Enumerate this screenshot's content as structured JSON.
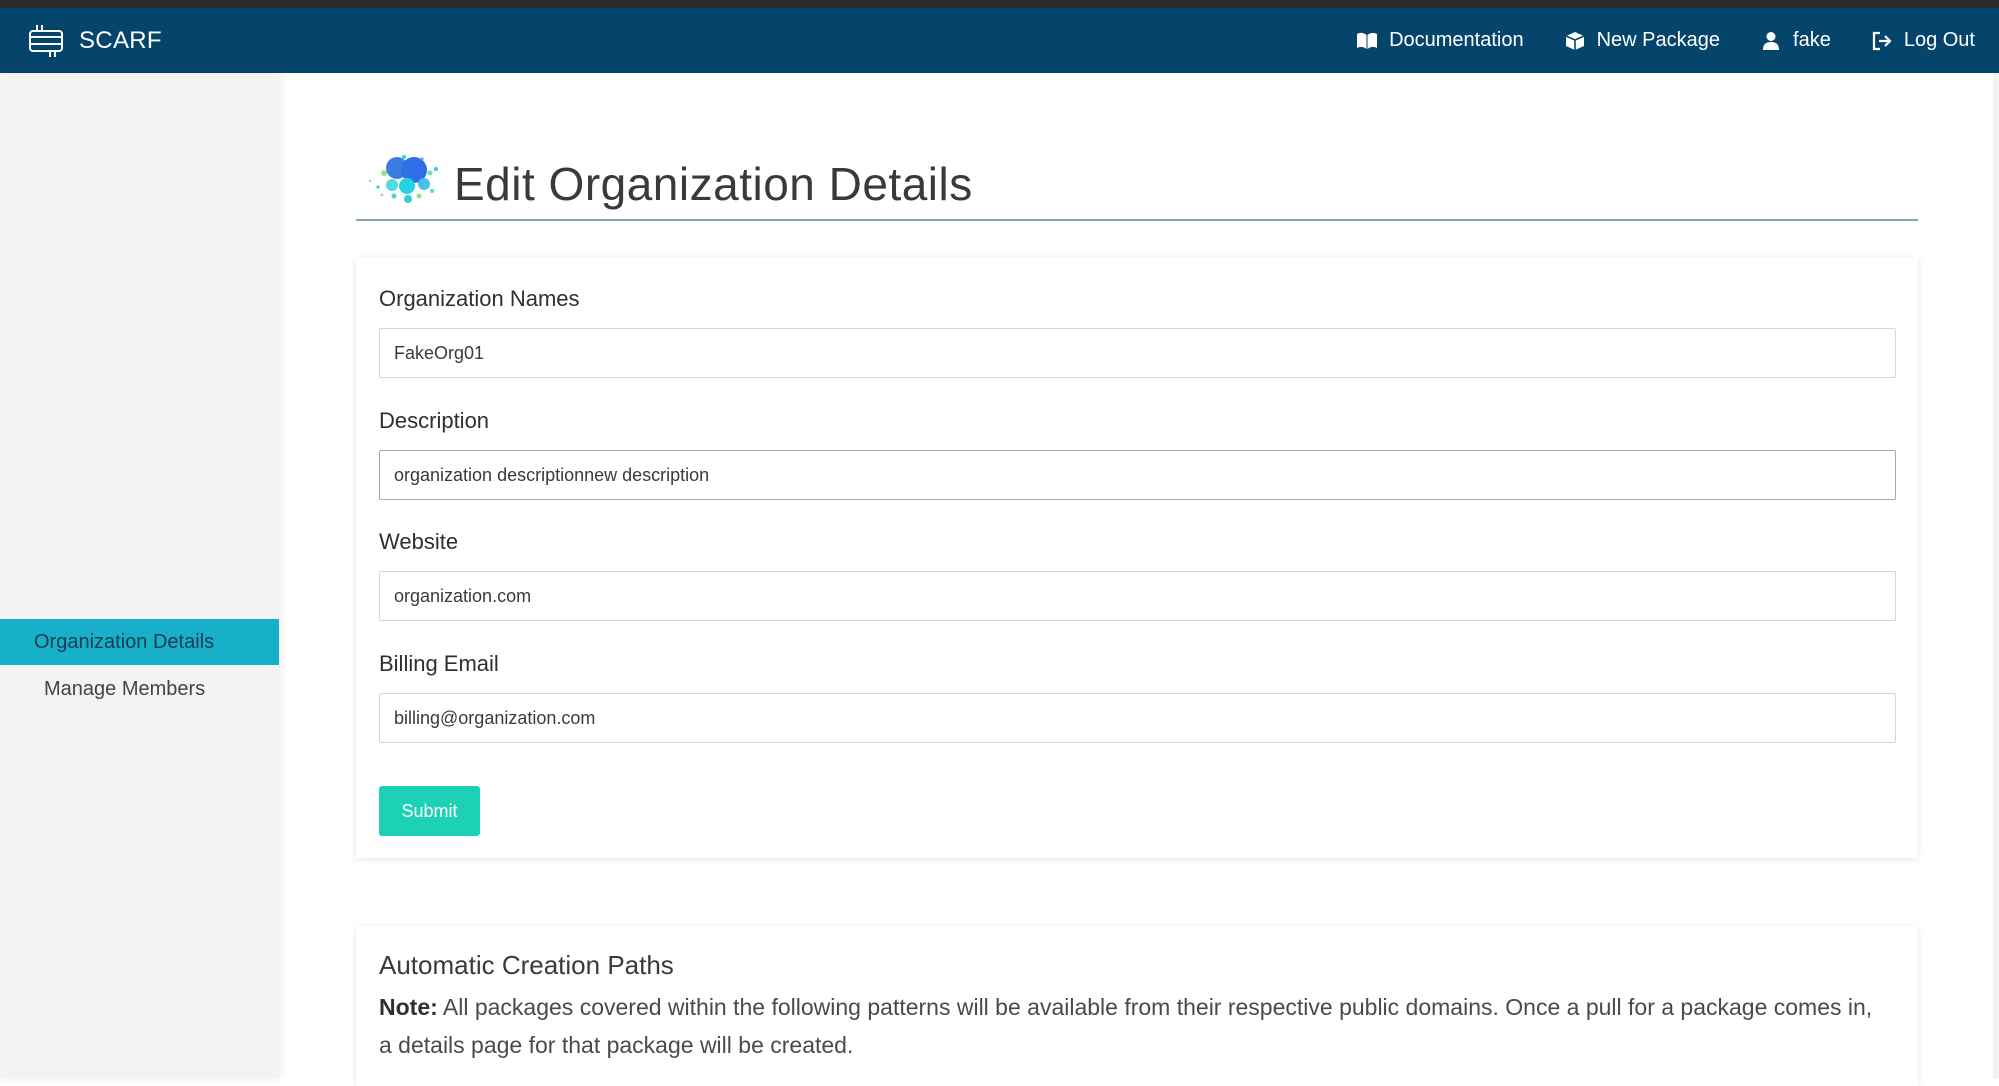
{
  "navbar": {
    "brand": "SCARF",
    "items": [
      {
        "label": "Documentation",
        "icon": "book-icon"
      },
      {
        "label": "New Package",
        "icon": "package-icon"
      },
      {
        "label": "fake",
        "icon": "user-icon"
      },
      {
        "label": "Log Out",
        "icon": "logout-icon"
      }
    ]
  },
  "sidebar": {
    "items": [
      {
        "label": "Organization Details",
        "active": true
      },
      {
        "label": "Manage Members",
        "active": false
      }
    ]
  },
  "page": {
    "title": "Edit Organization Details"
  },
  "form": {
    "fields": [
      {
        "label": "Organization Names",
        "value": "FakeOrg01"
      },
      {
        "label": "Description",
        "value": "organization descriptionnew description"
      },
      {
        "label": "Website",
        "value": "organization.com"
      },
      {
        "label": "Billing Email",
        "value": "billing@organization.com"
      }
    ],
    "submit_label": "Submit"
  },
  "paths": {
    "title": "Automatic Creation Paths",
    "note_label": "Note:",
    "note_text": " All packages covered within the following patterns will be available from their respective public domains. Once a pull for a package comes in, a details page for that package will be created."
  },
  "colors": {
    "navbar": "#06456b",
    "sidebar_active": "#17b0c8",
    "submit": "#1dd1b6"
  }
}
